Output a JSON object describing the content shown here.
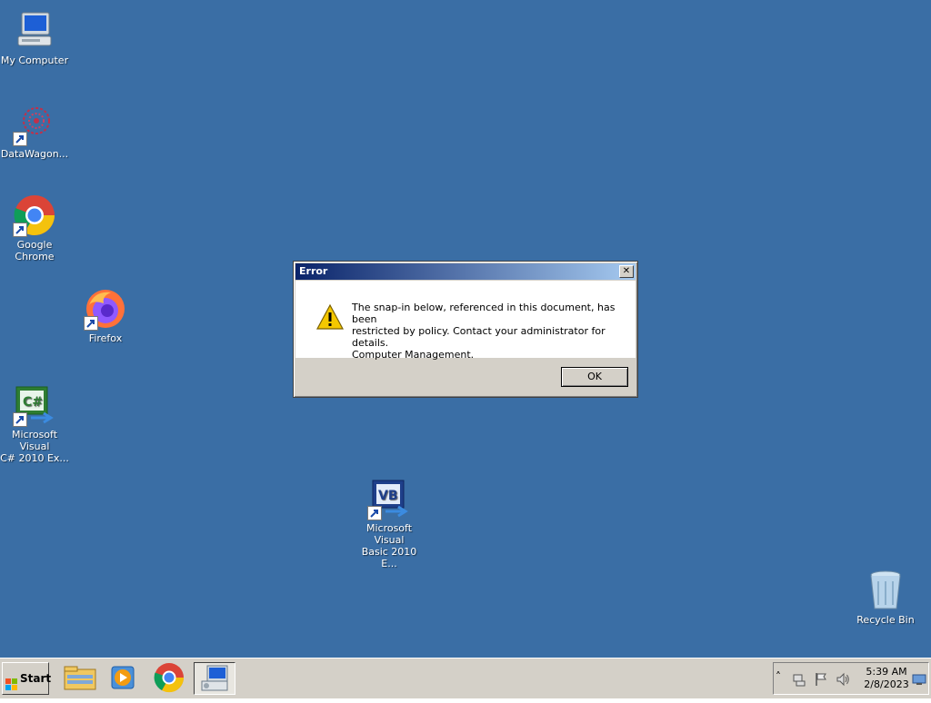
{
  "desktop": {
    "icons": [
      {
        "label": "My Computer"
      },
      {
        "label": "DataWagon..."
      },
      {
        "label": "Google Chrome"
      },
      {
        "label": "Firefox"
      },
      {
        "label": "Microsoft Visual\nC# 2010 Ex..."
      },
      {
        "label": "Microsoft Visual\nBasic 2010 E..."
      },
      {
        "label": "Recycle Bin"
      }
    ]
  },
  "dialog": {
    "title": "Error",
    "close_glyph": "✕",
    "message_lines": [
      "The snap-in below, referenced in this document, has been",
      "restricted by policy. Contact your administrator for details.",
      "Computer Management."
    ],
    "ok_label": "OK",
    "icon": "warning-icon"
  },
  "taskbar": {
    "start_label": "Start",
    "pinned": [
      {
        "icon": "file-explorer-icon"
      },
      {
        "icon": "media-player-icon"
      },
      {
        "icon": "chrome-icon"
      },
      {
        "icon": "computer-management-icon",
        "active": true
      }
    ],
    "tray": {
      "chevron": "˄",
      "time": "5:39 AM",
      "date": "2/8/2023"
    }
  },
  "colors": {
    "desktop": "#3a6ea5",
    "titlebar_start": "#0a246a",
    "titlebar_end": "#a6caf0",
    "face": "#d4d0c8"
  }
}
